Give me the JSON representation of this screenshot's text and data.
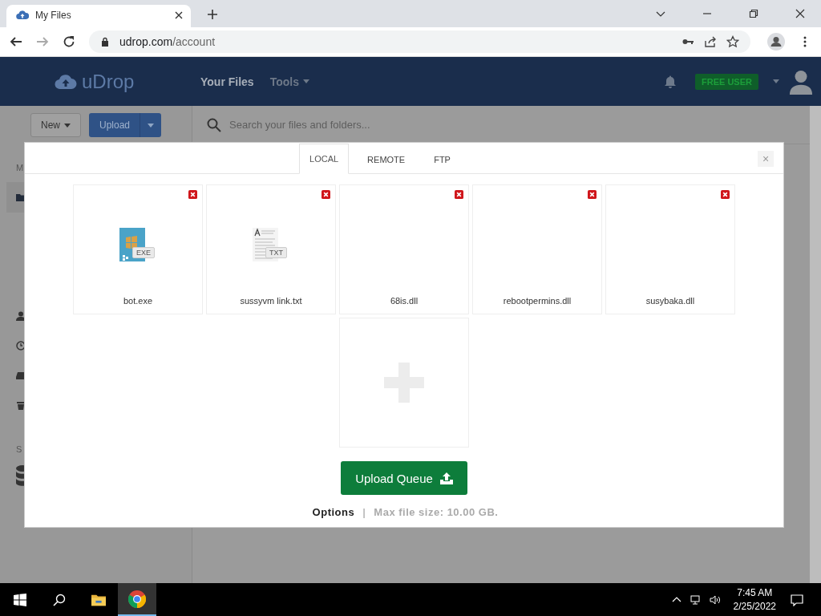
{
  "browser": {
    "tab_title": "My Files",
    "url_host": "udrop.com",
    "url_path": "/account"
  },
  "header": {
    "logo": "uDrop",
    "nav": [
      {
        "label": "Your Files",
        "selected": true
      },
      {
        "label": "Tools",
        "selected": false,
        "dropdown": true
      }
    ],
    "badge": "FREE USER"
  },
  "toolbar": {
    "new_button": "New",
    "upload_button": "Upload",
    "search": {
      "placeholder": "Search your files and folders..."
    }
  },
  "sidebar": {
    "labels": [
      "M",
      "S"
    ]
  },
  "modal": {
    "tabs": [
      {
        "label": "LOCAL",
        "selected": true
      },
      {
        "label": "REMOTE",
        "selected": false
      },
      {
        "label": "FTP",
        "selected": false
      }
    ],
    "close": "×",
    "files": [
      {
        "name": "bot.exe",
        "kind": "exe",
        "badge": "EXE"
      },
      {
        "name": "sussyvm link.txt",
        "kind": "txt",
        "badge": "TXT"
      },
      {
        "name": "68is.dll",
        "kind": "blank"
      },
      {
        "name": "rebootpermins.dll",
        "kind": "blank"
      },
      {
        "name": "susybaka.dll",
        "kind": "blank"
      }
    ],
    "upload_button": "Upload Queue",
    "options_link": "Options",
    "separator": "|",
    "max_size": "Max file size: 10.00 GB."
  },
  "taskbar": {
    "time": "7:45 AM",
    "date": "2/25/2022"
  }
}
